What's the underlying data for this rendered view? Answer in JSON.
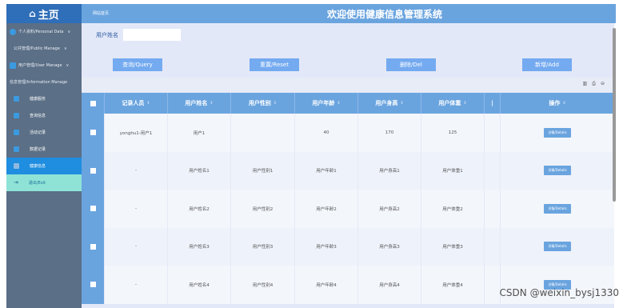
{
  "sidebar": {
    "home": "主页",
    "menus": [
      {
        "label": "个人资料/Personal Data"
      },
      {
        "label": "公共管理/Public Manage"
      },
      {
        "label": "用户管理/User Manage"
      },
      {
        "label": "信息管理/Information Manage"
      }
    ],
    "items": [
      {
        "label": "健康服务"
      },
      {
        "label": "查询信息"
      },
      {
        "label": "活动记录"
      },
      {
        "label": "数据记录"
      },
      {
        "label": "健康信息"
      },
      {
        "label": "退出/Exit"
      }
    ]
  },
  "header": {
    "breadcrumb": "网站首页",
    "title": "欢迎使用健康信息管理系统"
  },
  "search": {
    "label": "用户姓名",
    "placeholder": ""
  },
  "buttons": {
    "query": "查询/Query",
    "reset": "重置/Reset",
    "delete": "删除/Del",
    "add": "新增/Add"
  },
  "table": {
    "columns": [
      "记录人员",
      "用户姓名",
      "用户性别",
      "用户年龄",
      "用户身高",
      "用户体重",
      "操作"
    ],
    "rows": [
      [
        "yonghu1-用户1",
        "用户1",
        "",
        "40",
        "170",
        "125"
      ],
      [
        "-",
        "用户姓名1",
        "用户性别1",
        "用户年龄1",
        "用户身高1",
        "用户体重1"
      ],
      [
        "-",
        "用户姓名2",
        "用户性别2",
        "用户年龄2",
        "用户身高2",
        "用户体重2"
      ],
      [
        "-",
        "用户姓名3",
        "用户性别3",
        "用户年龄3",
        "用户身高3",
        "用户体重3"
      ],
      [
        "-",
        "用户姓名4",
        "用户性别4",
        "用户年龄4",
        "用户身高4",
        "用户体重4"
      ]
    ],
    "details_label": "详情/Details"
  },
  "watermark": "CSDN @weixin_bysj1330"
}
